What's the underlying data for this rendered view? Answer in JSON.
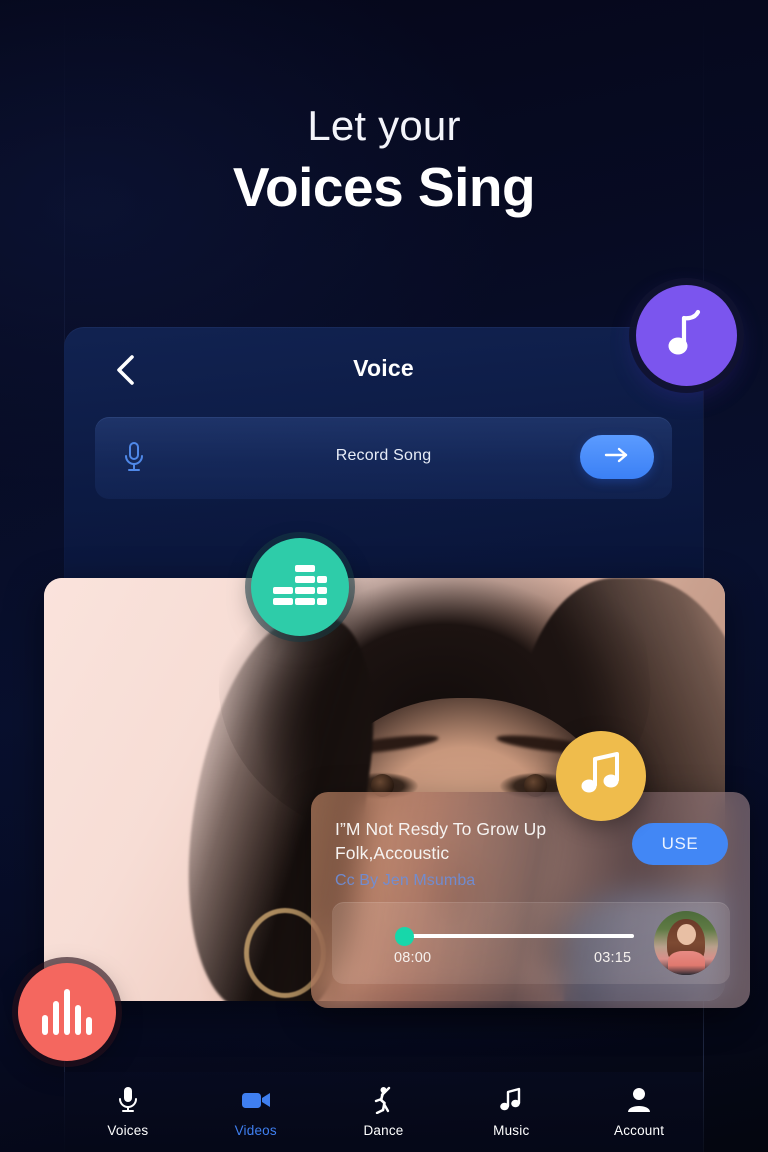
{
  "headline": {
    "line1": "Let your",
    "line2": "Voices Sing"
  },
  "voice_panel": {
    "title": "Voice",
    "back_icon": "chevron-left-icon",
    "record_row": {
      "mic_icon": "microphone-icon",
      "label": "Record Song",
      "go_icon": "arrow-right-icon"
    }
  },
  "song_card": {
    "title": "I”M Not Resdy To Grow Up Folk,Accoustic",
    "artist": "Cc By Jen Msumba",
    "use_label": "USE",
    "player": {
      "current_time": "08:00",
      "total_time": "03:15",
      "progress_percent": 4
    }
  },
  "badges": [
    {
      "name": "music-note-badge",
      "icon": "music-note-icon",
      "color": "#7b55ee"
    },
    {
      "name": "equalizer-badge",
      "icon": "equalizer-icon",
      "color": "#2ecca9"
    },
    {
      "name": "double-note-badge",
      "icon": "double-music-note-icon",
      "color": "#efbc4c"
    },
    {
      "name": "waveform-badge",
      "icon": "waveform-icon",
      "color": "#f4675f"
    }
  ],
  "bottom_nav": {
    "active_index": 1,
    "items": [
      {
        "label": "Voices",
        "icon": "microphone-icon"
      },
      {
        "label": "Videos",
        "icon": "video-camera-icon"
      },
      {
        "label": "Dance",
        "icon": "dancer-icon"
      },
      {
        "label": "Music",
        "icon": "music-note-icon"
      },
      {
        "label": "Account",
        "icon": "person-icon"
      }
    ]
  },
  "colors": {
    "background_dark": "#05071a",
    "panel_blue": "#122454",
    "accent_blue": "#4287f5",
    "purple": "#7b55ee",
    "teal": "#2ecca9",
    "amber": "#efbc4c",
    "coral": "#f4675f",
    "slider_thumb": "#17d7aa"
  }
}
